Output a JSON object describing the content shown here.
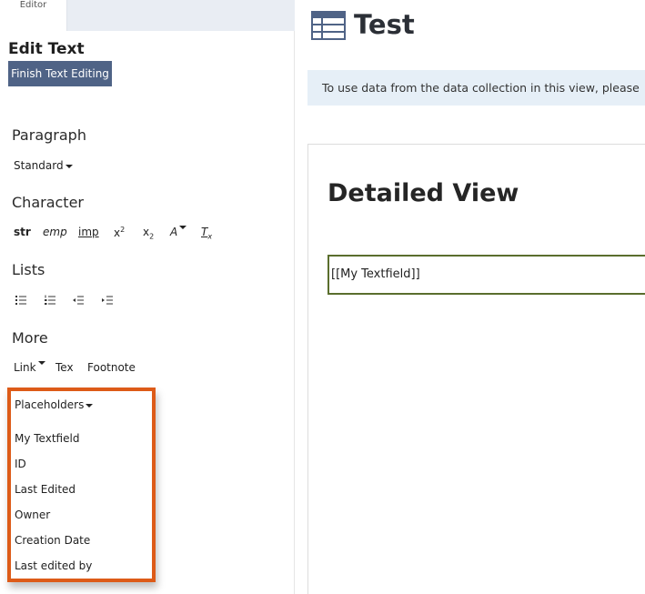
{
  "left_panel": {
    "tab_label": "Editor",
    "title": "Edit Text",
    "finish_button": "Finish Text Editing",
    "paragraph": {
      "title": "Paragraph",
      "style_value": "Standard"
    },
    "character": {
      "title": "Character",
      "items": {
        "str": "str",
        "emp": "emp",
        "imp": "imp",
        "sup_base": "x",
        "sup_exp": "2",
        "sub_base": "x",
        "sub_exp": "2",
        "font_color": "A",
        "clear_base": "T",
        "clear_sub": "x"
      }
    },
    "lists": {
      "title": "Lists"
    },
    "more": {
      "title": "More",
      "link": "Link",
      "tex": "Tex",
      "footnote": "Footnote"
    },
    "placeholders": {
      "title": "Placeholders",
      "items": [
        "My Textfield",
        "ID",
        "Last Edited",
        "Owner",
        "Creation Date",
        "Last edited by"
      ]
    }
  },
  "main": {
    "title": "Test",
    "info_text": "To use data from the data collection in this view, please",
    "card_title": "Detailed View",
    "textfield_value": "[[My Textfield]]"
  },
  "colors": {
    "finish_button_bg": "#4f6386",
    "highlight_border": "#dd5b18",
    "info_bar_bg": "#e6eff7",
    "textfield_border": "#5a6e2d"
  },
  "icons": [
    "table-icon",
    "bulleted-list-icon",
    "numbered-list-icon",
    "outdent-icon",
    "indent-icon",
    "dropdown-caret-icon"
  ]
}
